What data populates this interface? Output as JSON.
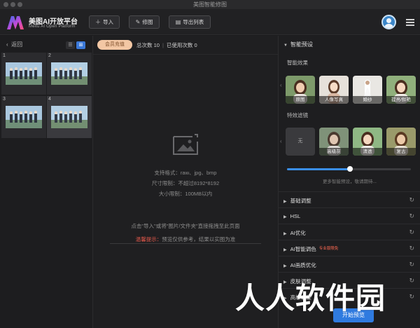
{
  "window": {
    "title": "美图智能修图"
  },
  "header": {
    "brand_name": "美图AI开放平台",
    "brand_sub": "Meitu AI Open Platform",
    "import_label": "导入",
    "retouch_label": "修图",
    "export_list_label": "导出列表"
  },
  "left_panel": {
    "back_label": "返回",
    "view_list_icon": "list-icon",
    "view_grid_icon": "grid-icon",
    "thumbnails": [
      {
        "num": "1"
      },
      {
        "num": "2"
      },
      {
        "num": "3"
      },
      {
        "num": "4"
      }
    ]
  },
  "center": {
    "recharge_label": "会员充值",
    "total_count": "总次数 10",
    "used_count": "已使用次数 0",
    "formats": "支持格式：raw、jpg、bmp",
    "size_limit": "尺寸限制：不超过8192*8192",
    "file_limit": "大小限制：100MB以内",
    "drop_hint": "点击\"导入\"或将\"图片/文件夹\"直接拖拽至此页面",
    "tip_label": "温馨提示：",
    "tip_text": "预览仅供参考，结果以实图为准"
  },
  "right_panel": {
    "preset_title": "智能预设",
    "effects_label": "智能效果",
    "effects": [
      {
        "label": "原图"
      },
      {
        "label": "人像写真"
      },
      {
        "label": "婚纱"
      },
      {
        "label": "提亮/鲜艳"
      }
    ],
    "filters_label": "特效滤镜",
    "filters": [
      {
        "label": "无"
      },
      {
        "label": "高级灰"
      },
      {
        "label": "清透"
      },
      {
        "label": "复古"
      }
    ],
    "slider_level": 0.51,
    "more_tip": "更多智能预设，敬请期待...",
    "sections": [
      {
        "label": "基础调整",
        "badge": ""
      },
      {
        "label": "HSL",
        "badge": ""
      },
      {
        "label": "AI优化",
        "badge": ""
      },
      {
        "label": "AI智能调色",
        "badge": "专业版限免"
      },
      {
        "label": "AI画质优化",
        "badge": ""
      },
      {
        "label": "皮肤调整",
        "badge": ""
      },
      {
        "label": "高级调整",
        "badge": ""
      }
    ]
  },
  "footer": {
    "preview_label": "开始预览"
  },
  "watermark": {
    "text": "人人软件园"
  },
  "colors": {
    "accent": "#2f7be0",
    "recharge_bg": "#f3c7a4",
    "warning": "#e0574a"
  }
}
